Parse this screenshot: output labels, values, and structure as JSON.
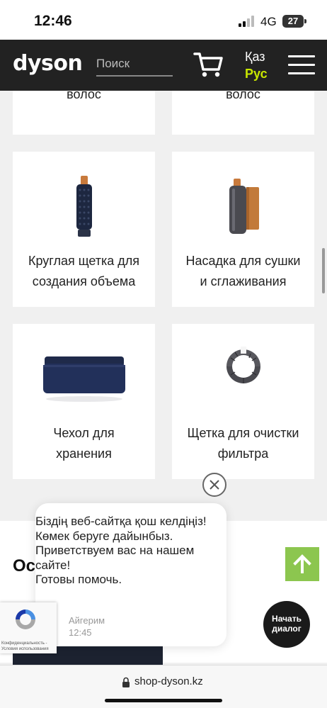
{
  "status_bar": {
    "time": "12:46",
    "network": "4G",
    "battery": "27"
  },
  "header": {
    "logo": "dyson",
    "search_placeholder": "Поиск",
    "lang_kaz": "Қаз",
    "lang_rus": "Рус"
  },
  "products": [
    {
      "title": "выпрямления\nволос",
      "icon": "straightener-image"
    },
    {
      "title": "выпрямления\nволос",
      "icon": "straightener-image"
    },
    {
      "title": "Круглая щетка для\nсоздания объема",
      "icon": "round-brush-image"
    },
    {
      "title": "Насадка для сушки\nи сглаживания",
      "icon": "smoothing-attachment-image"
    },
    {
      "title": "Чехол для\nхранения",
      "icon": "storage-case-image"
    },
    {
      "title": "Щетка для очистки\nфильтра",
      "icon": "filter-cleaning-brush-image"
    }
  ],
  "chat": {
    "message": "Біздің веб-сайтқа қош келдіңіз!\nКөмек беруге дайынбыз.\nПриветствуем вас на нашем сайте!\nГотовы помочь.",
    "agent_name": "Айгерим",
    "agent_time": "12:45",
    "start_button": "Начать\nдиалог"
  },
  "partial_heading": "Ос",
  "recaptcha_text": "Конфиденциальность - Условия использования",
  "browser": {
    "url": "shop-dyson.kz"
  },
  "colors": {
    "header_bg": "#222222",
    "accent_lang": "#c8e600",
    "scroll_top_green": "#8cc64f"
  }
}
